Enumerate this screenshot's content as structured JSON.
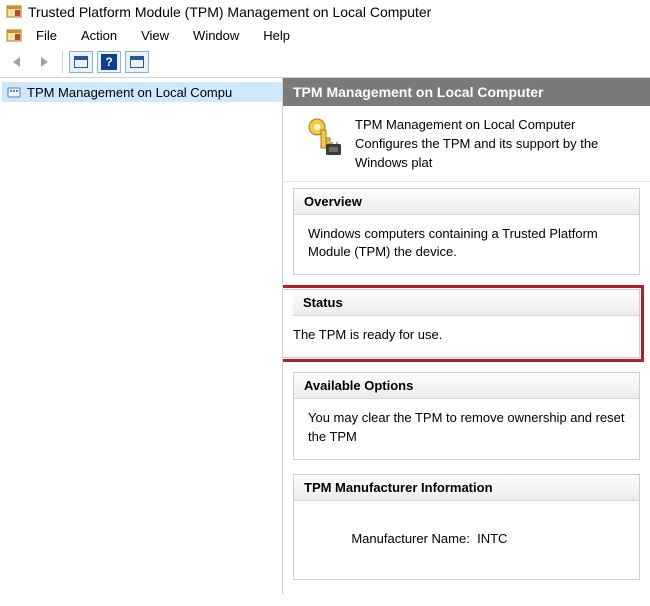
{
  "window": {
    "title": "Trusted Platform Module (TPM) Management on Local Computer"
  },
  "menus": {
    "file": "File",
    "action": "Action",
    "view": "View",
    "window": "Window",
    "help": "Help"
  },
  "tree": {
    "root_label": "TPM Management on Local Compu"
  },
  "content": {
    "header": "TPM Management on Local Computer",
    "intro_title": "TPM Management on Local Computer",
    "intro_desc": "Configures the TPM and its support by the Windows plat"
  },
  "sections": {
    "overview": {
      "title": "Overview",
      "body": "Windows computers containing a Trusted Platform Module (TPM) the device."
    },
    "status": {
      "title": "Status",
      "body": "The TPM is ready for use."
    },
    "options": {
      "title": "Available Options",
      "body": "You may clear the TPM to remove ownership and reset the TPM"
    },
    "manufacturer": {
      "title": "TPM Manufacturer Information",
      "name_label": "Manufacturer Name:",
      "name_value": "INTC"
    }
  }
}
